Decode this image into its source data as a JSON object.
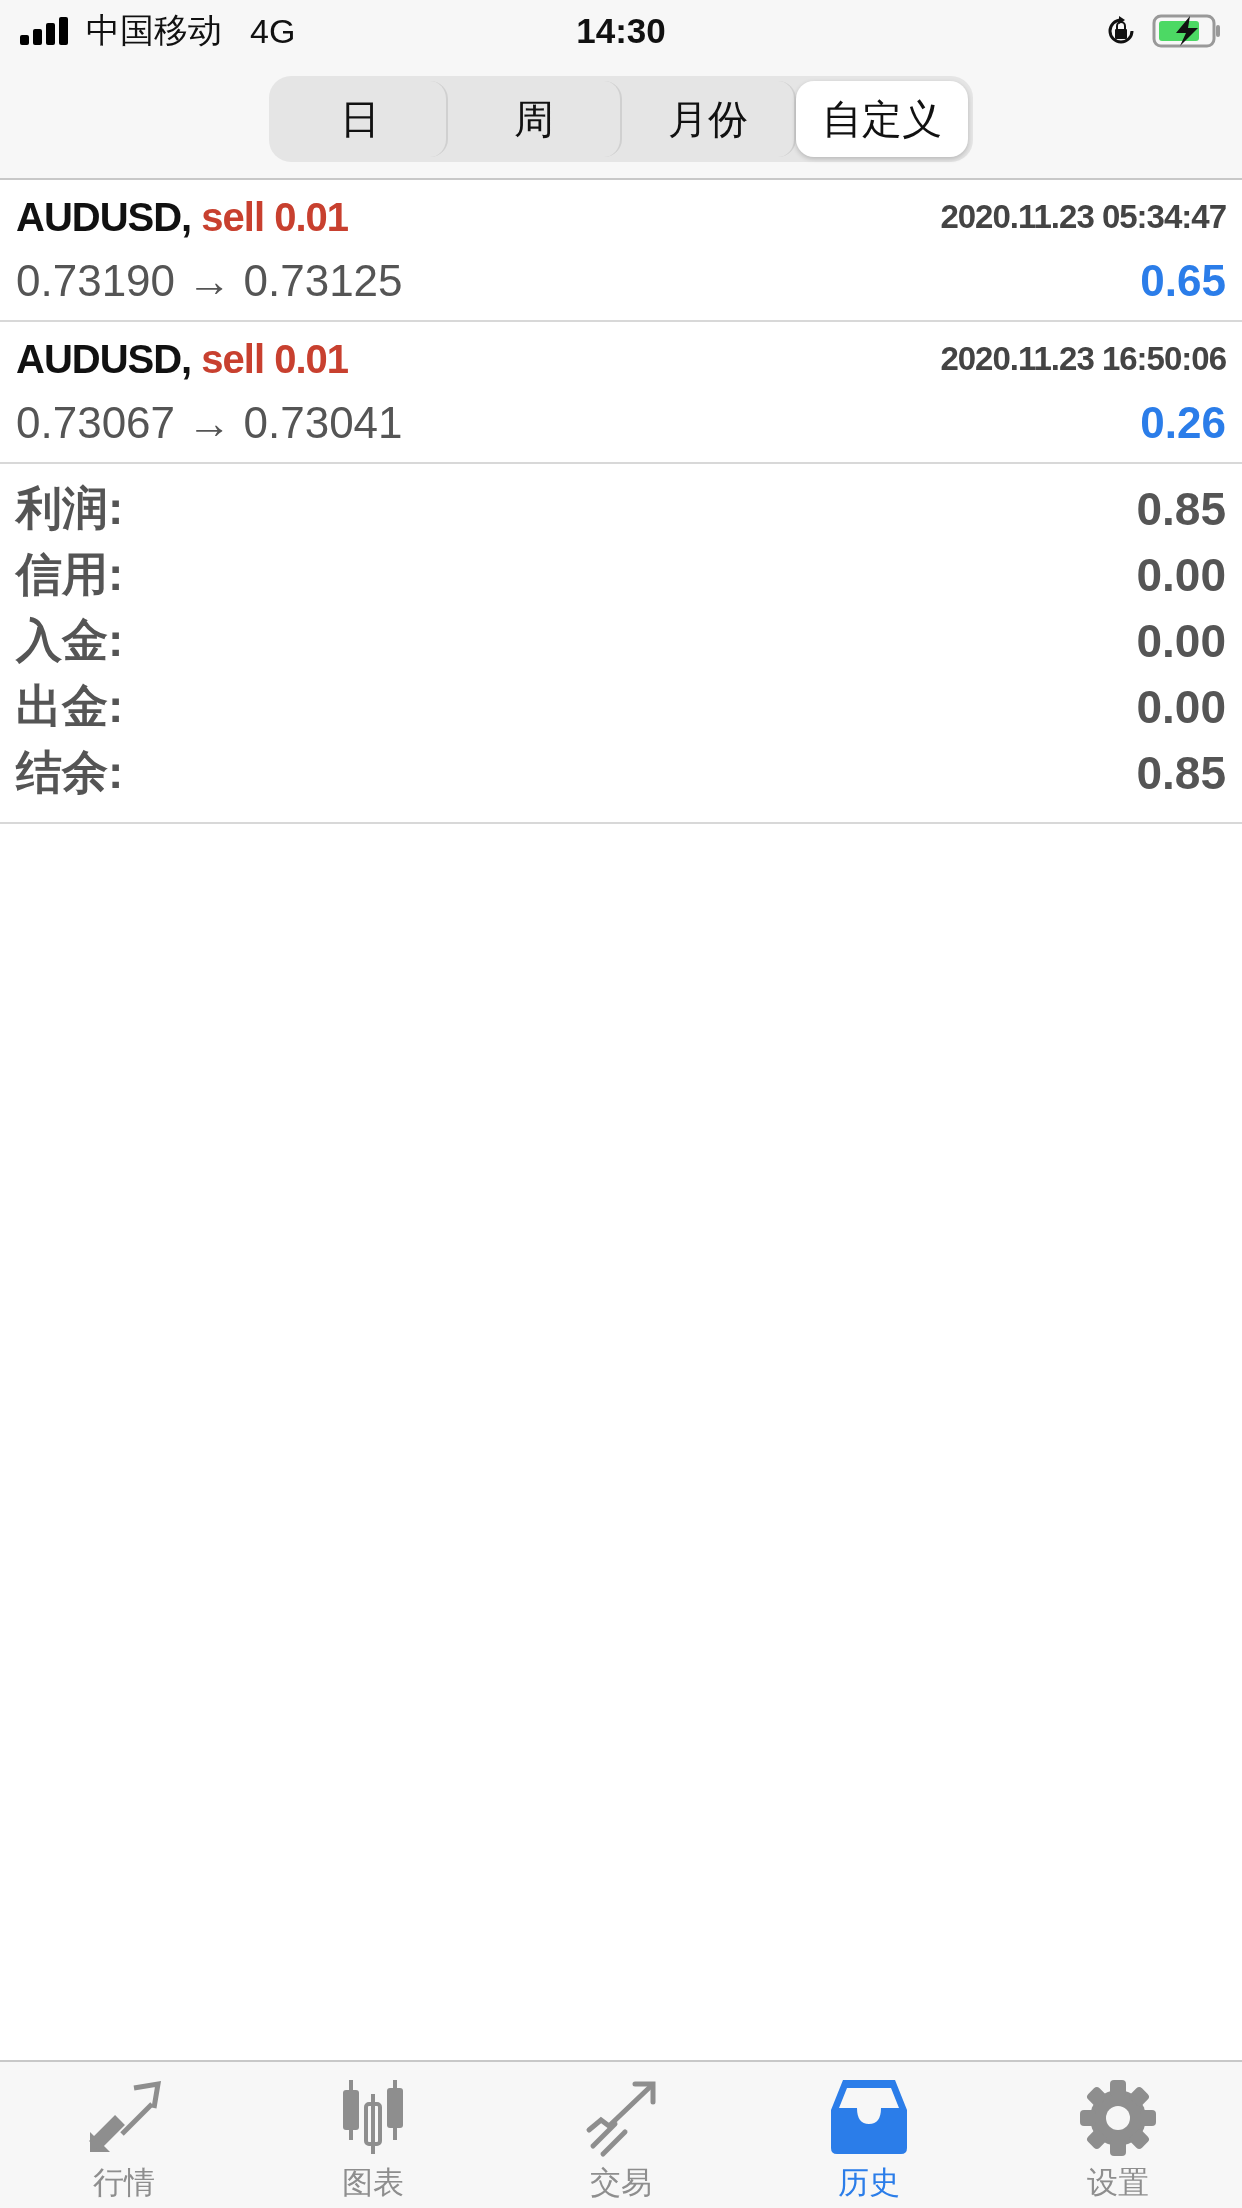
{
  "status_bar": {
    "carrier": "中国移动",
    "network": "4G",
    "time": "14:30"
  },
  "segments": [
    {
      "label": "日",
      "selected": false
    },
    {
      "label": "周",
      "selected": false
    },
    {
      "label": "月份",
      "selected": false
    },
    {
      "label": "自定义",
      "selected": true
    }
  ],
  "trades": [
    {
      "symbol": "AUDUSD,",
      "side": "sell 0.01",
      "time": "2020.11.23 05:34:47",
      "prices": "0.73190 → 0.73125",
      "profit": "0.65"
    },
    {
      "symbol": "AUDUSD,",
      "side": "sell 0.01",
      "time": "2020.11.23 16:50:06",
      "prices": "0.73067 → 0.73041",
      "profit": "0.26"
    }
  ],
  "summary": [
    {
      "label": "利润:",
      "value": "0.85"
    },
    {
      "label": "信用:",
      "value": "0.00"
    },
    {
      "label": "入金:",
      "value": "0.00"
    },
    {
      "label": "出金:",
      "value": "0.00"
    },
    {
      "label": "结余:",
      "value": "0.85"
    }
  ],
  "tab_bar": [
    {
      "label": "行情",
      "kind": "quotes",
      "selected": false
    },
    {
      "label": "图表",
      "kind": "chart",
      "selected": false
    },
    {
      "label": "交易",
      "kind": "trade",
      "selected": false
    },
    {
      "label": "历史",
      "kind": "history",
      "selected": true
    },
    {
      "label": "设置",
      "kind": "settings",
      "selected": false
    }
  ]
}
